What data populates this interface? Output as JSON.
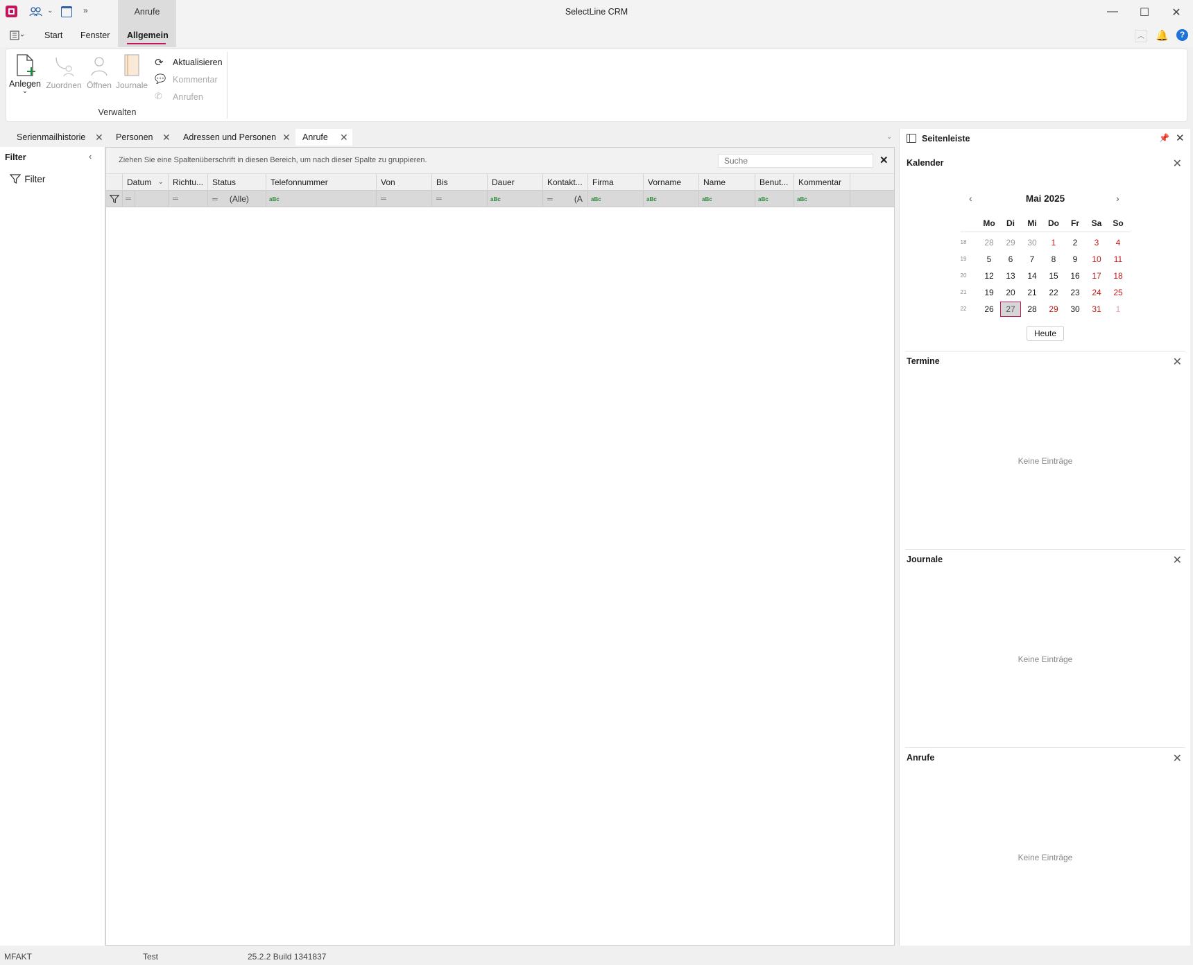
{
  "window": {
    "title": "SelectLine CRM",
    "context_tab": "Anrufe",
    "controls": {
      "minimize": "—",
      "maximize": "☐",
      "close": "✕"
    }
  },
  "menu": {
    "items": [
      "Start",
      "Fenster",
      "Allgemein"
    ],
    "active": "Allgemein"
  },
  "ribbon": {
    "buttons": {
      "anlegen": "Anlegen",
      "zuordnen": "Zuordnen",
      "oeffnen": "Öffnen",
      "journale": "Journale",
      "aktualisieren": "Aktualisieren",
      "kommentar": "Kommentar",
      "anrufen": "Anrufen"
    },
    "group_label": "Verwalten"
  },
  "doc_tabs": [
    "Serienmailhistorie",
    "Personen",
    "Adressen und Personen",
    "Anrufe"
  ],
  "filter_panel": {
    "title": "Filter",
    "item": "Filter"
  },
  "grid": {
    "group_hint": "Ziehen Sie eine Spaltenüberschrift in diesen Bereich, um nach dieser Spalte zu gruppieren.",
    "search_placeholder": "Suche",
    "columns": [
      "Datum",
      "Richtu...",
      "Status",
      "Telefonnummer",
      "Von",
      "Bis",
      "Dauer",
      "Kontakt...",
      "Firma",
      "Vorname",
      "Name",
      "Benut...",
      "Kommentar"
    ],
    "filter_row": {
      "status_value": "(Alle)",
      "kontakt_value": "(A"
    },
    "rows": []
  },
  "sidebar": {
    "title": "Seitenleiste",
    "calendar": {
      "title": "Kalender",
      "month": "Mai 2025",
      "weekdays": [
        "Mo",
        "Di",
        "Mi",
        "Do",
        "Fr",
        "Sa",
        "So"
      ],
      "weeks": [
        {
          "wk": "18",
          "days": [
            "28",
            "29",
            "30",
            "1",
            "2",
            "3",
            "4"
          ]
        },
        {
          "wk": "19",
          "days": [
            "5",
            "6",
            "7",
            "8",
            "9",
            "10",
            "11"
          ]
        },
        {
          "wk": "20",
          "days": [
            "12",
            "13",
            "14",
            "15",
            "16",
            "17",
            "18"
          ]
        },
        {
          "wk": "21",
          "days": [
            "19",
            "20",
            "21",
            "22",
            "23",
            "24",
            "25"
          ]
        },
        {
          "wk": "22",
          "days": [
            "26",
            "27",
            "28",
            "29",
            "30",
            "31",
            "1"
          ]
        }
      ],
      "selected_day": "27",
      "today_button": "Heute"
    },
    "termine": {
      "title": "Termine",
      "empty": "Keine Einträge"
    },
    "journale": {
      "title": "Journale",
      "empty": "Keine Einträge"
    },
    "anrufe": {
      "title": "Anrufe",
      "empty": "Keine Einträge"
    }
  },
  "status_bar": {
    "mandant": "MFAKT",
    "db": "Test",
    "version": "25.2.2 Build 1341837"
  },
  "colors": {
    "accent": "#c2185b",
    "weekend_red": "#c21a1a",
    "filter_row": "#d9d9d9"
  }
}
